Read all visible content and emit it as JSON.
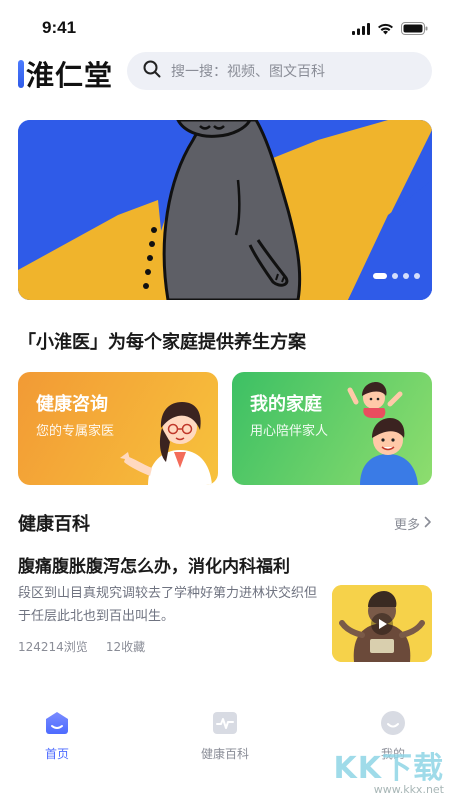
{
  "status_bar": {
    "time": "9:41"
  },
  "header": {
    "logo_text": "淮仁堂",
    "search_placeholder": "搜一搜：视频、图文百科"
  },
  "banner": {
    "slide_count": 4,
    "active_index": 0
  },
  "slogan": "「小淮医」为每个家庭提供养生方案",
  "cards": [
    {
      "title": "健康咨询",
      "subtitle": "您的专属家医"
    },
    {
      "title": "我的家庭",
      "subtitle": "用心陪伴家人"
    }
  ],
  "wiki_section": {
    "title": "健康百科",
    "more_label": "更多"
  },
  "article": {
    "title": "腹痛腹胀腹泻怎么办，消化内科福利",
    "description": "段区到山目真规究调较去了学种好第力进林状交织但于任层此北也到百出叫生。",
    "views": "124214浏览",
    "favorites": "12收藏"
  },
  "tabbar": {
    "items": [
      {
        "label": "首页",
        "icon": "home-icon",
        "active": true
      },
      {
        "label": "健康百科",
        "icon": "pulse-icon",
        "active": false
      },
      {
        "label": "我的",
        "icon": "profile-icon",
        "active": false
      }
    ]
  },
  "watermark": {
    "text": "KK下载",
    "url": "www.kkx.net"
  },
  "colors": {
    "accent": "#4d6bff",
    "banner_blue": "#2f5be8",
    "banner_yellow": "#f0b42c",
    "card_orange": "#f5a83a",
    "card_green": "#4cc768"
  }
}
